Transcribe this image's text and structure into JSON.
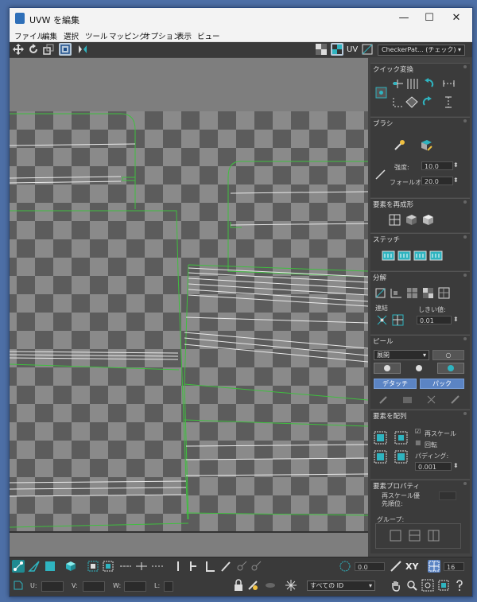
{
  "window": {
    "title": "UVW を編集",
    "minimize": "—",
    "maximize": "☐",
    "close": "✕"
  },
  "menu": [
    "ファイル",
    "編集",
    "選択",
    "ツール",
    "マッピング",
    "オプション",
    "表示",
    "ビュー"
  ],
  "toolbar": {
    "uv_label": "UV",
    "texture_select": "CheckerPat... (チェック)"
  },
  "sections": {
    "quick_transform": "クイック変換",
    "brush": {
      "title": "ブラシ",
      "strength_label": "強度:",
      "strength_value": "10.0",
      "falloff_label": "フォールオフ:",
      "falloff_value": "20.0"
    },
    "reshape": "要素を再成形",
    "stitch": "ステッチ",
    "explode": {
      "title": "分解",
      "weld": "連結",
      "threshold_label": "しきい値:",
      "threshold_value": "0.01"
    },
    "peel": {
      "title": "ピール",
      "mode": "展開",
      "detach": "デタッチ",
      "pack": "パック"
    },
    "arrange": {
      "title": "要素を配列",
      "rescale": "再スケール",
      "rotate": "回転",
      "padding_label": "パディング:",
      "padding_value": "0.001"
    },
    "properties": {
      "title": "要素プロパティ",
      "rescale_priority_line1": "再スケール優",
      "rescale_priority_line2": "先順位:",
      "group_label": "グループ:"
    }
  },
  "bottom": {
    "angle_value": "0.0",
    "xy_label": "XY",
    "grid_value": "16",
    "u_label": "U:",
    "v_label": "V:",
    "w_label": "W:",
    "l_label": "L:",
    "id_select": "すべての ID"
  },
  "colors": {
    "accent": "#2fb4c0",
    "selection": "#1f8a91",
    "uv_green": "#3fbf3f",
    "checker_light": "#8a8a8a",
    "checker_dark": "#5c5c5c"
  }
}
